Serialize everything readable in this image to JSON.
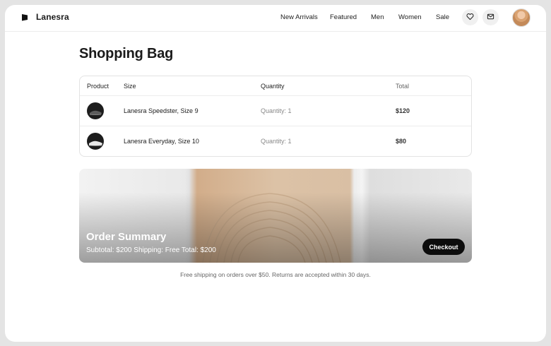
{
  "header": {
    "brand": "Lanesra",
    "nav": [
      "New Arrivals",
      "Featured",
      "Men",
      "Women",
      "Sale"
    ],
    "icons": [
      "flag-icon",
      "heart-icon",
      "mail-icon",
      "avatar"
    ]
  },
  "page": {
    "title": "Shopping Bag"
  },
  "table": {
    "headers": {
      "product": "Product",
      "size": "Size",
      "quantity": "Quantity",
      "total": "Total"
    },
    "rows": [
      {
        "size": "Lanesra Speedster, Size 9",
        "quantity": "Quantity: 1",
        "total": "$120"
      },
      {
        "size": "Lanesra Everyday, Size 10",
        "quantity": "Quantity: 1",
        "total": "$80"
      }
    ]
  },
  "summary": {
    "title": "Order Summary",
    "details": "Subtotal: $200 Shipping: Free Total: $200",
    "checkout_label": "Checkout"
  },
  "footer": {
    "note": "Free shipping on orders over $50. Returns are accepted within 30 days."
  },
  "colors": {
    "accent": "#0c0c0c",
    "background": "#ffffff"
  }
}
